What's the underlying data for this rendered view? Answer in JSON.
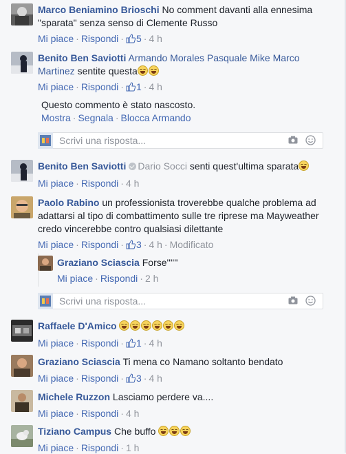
{
  "labels": {
    "like": "Mi piace",
    "reply": "Rispondi",
    "dot": "·",
    "modified": "Modificato",
    "reply_placeholder": "Scrivi una risposta...",
    "hidden_notice": "Questo commento è stato nascosto.",
    "show": "Mostra",
    "report": "Segnala",
    "block": "Blocca Armando"
  },
  "comments": [
    {
      "author": "Marco Beniamino Brioschi",
      "text": "No comment davanti alla ennesima \"sparata\" senza senso di Clemente Russo",
      "likes": "5",
      "time": "4 h"
    },
    {
      "author": "Benito Ben Saviotti",
      "mention": "Armando Morales Pasquale Mike Marco Martinez",
      "text": "sentite questa",
      "likes": "1",
      "time": "4 h"
    },
    {
      "author": "Benito Ben Saviotti",
      "mention": "Dario Socci",
      "text": "senti quest'ultima sparata",
      "time": "4 h"
    },
    {
      "author": "Paolo Rabino",
      "text": "un professionista troverebbe qualche problema ad adattarsi al tipo di combattimento sulle tre riprese ma Mayweather credo vincerebbe contro qualsiasi dilettante",
      "likes": "3",
      "time": "4 h"
    },
    {
      "author": "Graziano Sciascia",
      "text": "Forse''''''",
      "time": "2 h"
    },
    {
      "author": "Raffaele D'Amico",
      "likes": "1",
      "time": "4 h"
    },
    {
      "author": "Graziano Sciascia",
      "text": "Ti mena co Namano soltanto bendato",
      "likes": "3",
      "time": "4 h"
    },
    {
      "author": "Michele Ruzzon",
      "text": "Lasciamo perdere va....",
      "time": "4 h"
    },
    {
      "author": "Tiziano Campus",
      "text": "Che buffo",
      "time": "1 h"
    }
  ],
  "colors": {
    "link": "#4267b2",
    "author": "#365899",
    "meta": "#90949c",
    "background": "#f6f7f9"
  },
  "icons": [
    "thumbs-up-icon",
    "camera-icon",
    "smiley-icon",
    "emoji-laugh-icon",
    "verified-icon"
  ]
}
